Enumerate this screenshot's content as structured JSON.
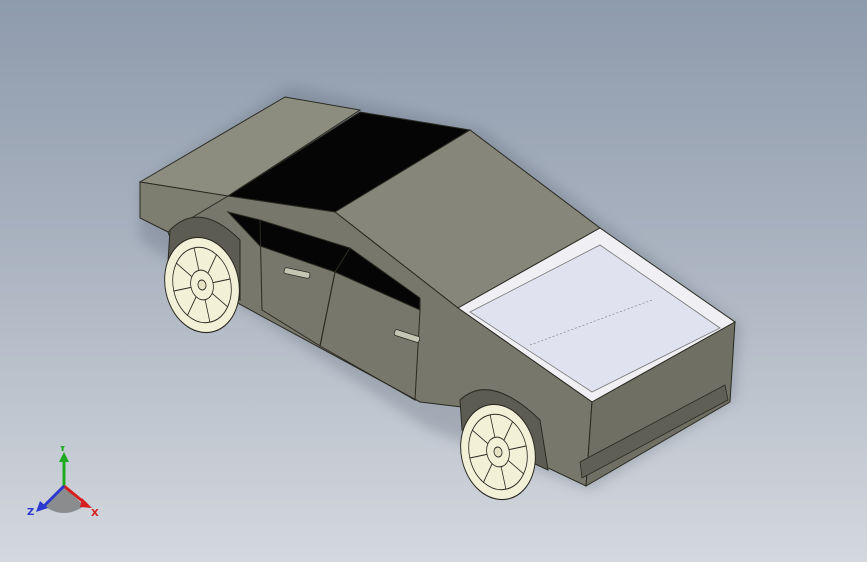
{
  "viewport": {
    "background_top": "#8e9bac",
    "background_bottom": "#d4d8de"
  },
  "model": {
    "body_color": "#8a8a7a",
    "glass_color": "#050505",
    "bed_color": "#e3e4ec",
    "wheel_color": "#f3f0d8"
  },
  "triad": {
    "x_label": "X",
    "y_label": "Y",
    "z_label": "Z",
    "x_color": "#d62020",
    "y_color": "#1faa1f",
    "z_color": "#2a38d0"
  }
}
